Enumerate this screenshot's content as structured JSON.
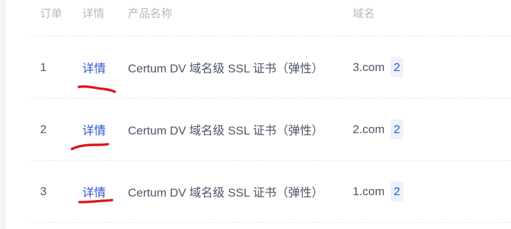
{
  "table": {
    "headers": {
      "order": "订单",
      "detail": "详情",
      "product": "产品名称",
      "domain": "域名"
    },
    "rows": [
      {
        "order": "1",
        "detail": "详情",
        "product": "Certum DV 域名级 SSL 证书（弹性）",
        "domain": "3.com",
        "count": "2"
      },
      {
        "order": "2",
        "detail": "详情",
        "product": "Certum DV 域名级 SSL 证书（弹性）",
        "domain": "2.com",
        "count": "2"
      },
      {
        "order": "3",
        "detail": "详情",
        "product": "Certum DV 域名级 SSL 证书（弹性）",
        "domain": "1.com",
        "count": "2"
      }
    ]
  },
  "annotation_color": "#e0131a"
}
